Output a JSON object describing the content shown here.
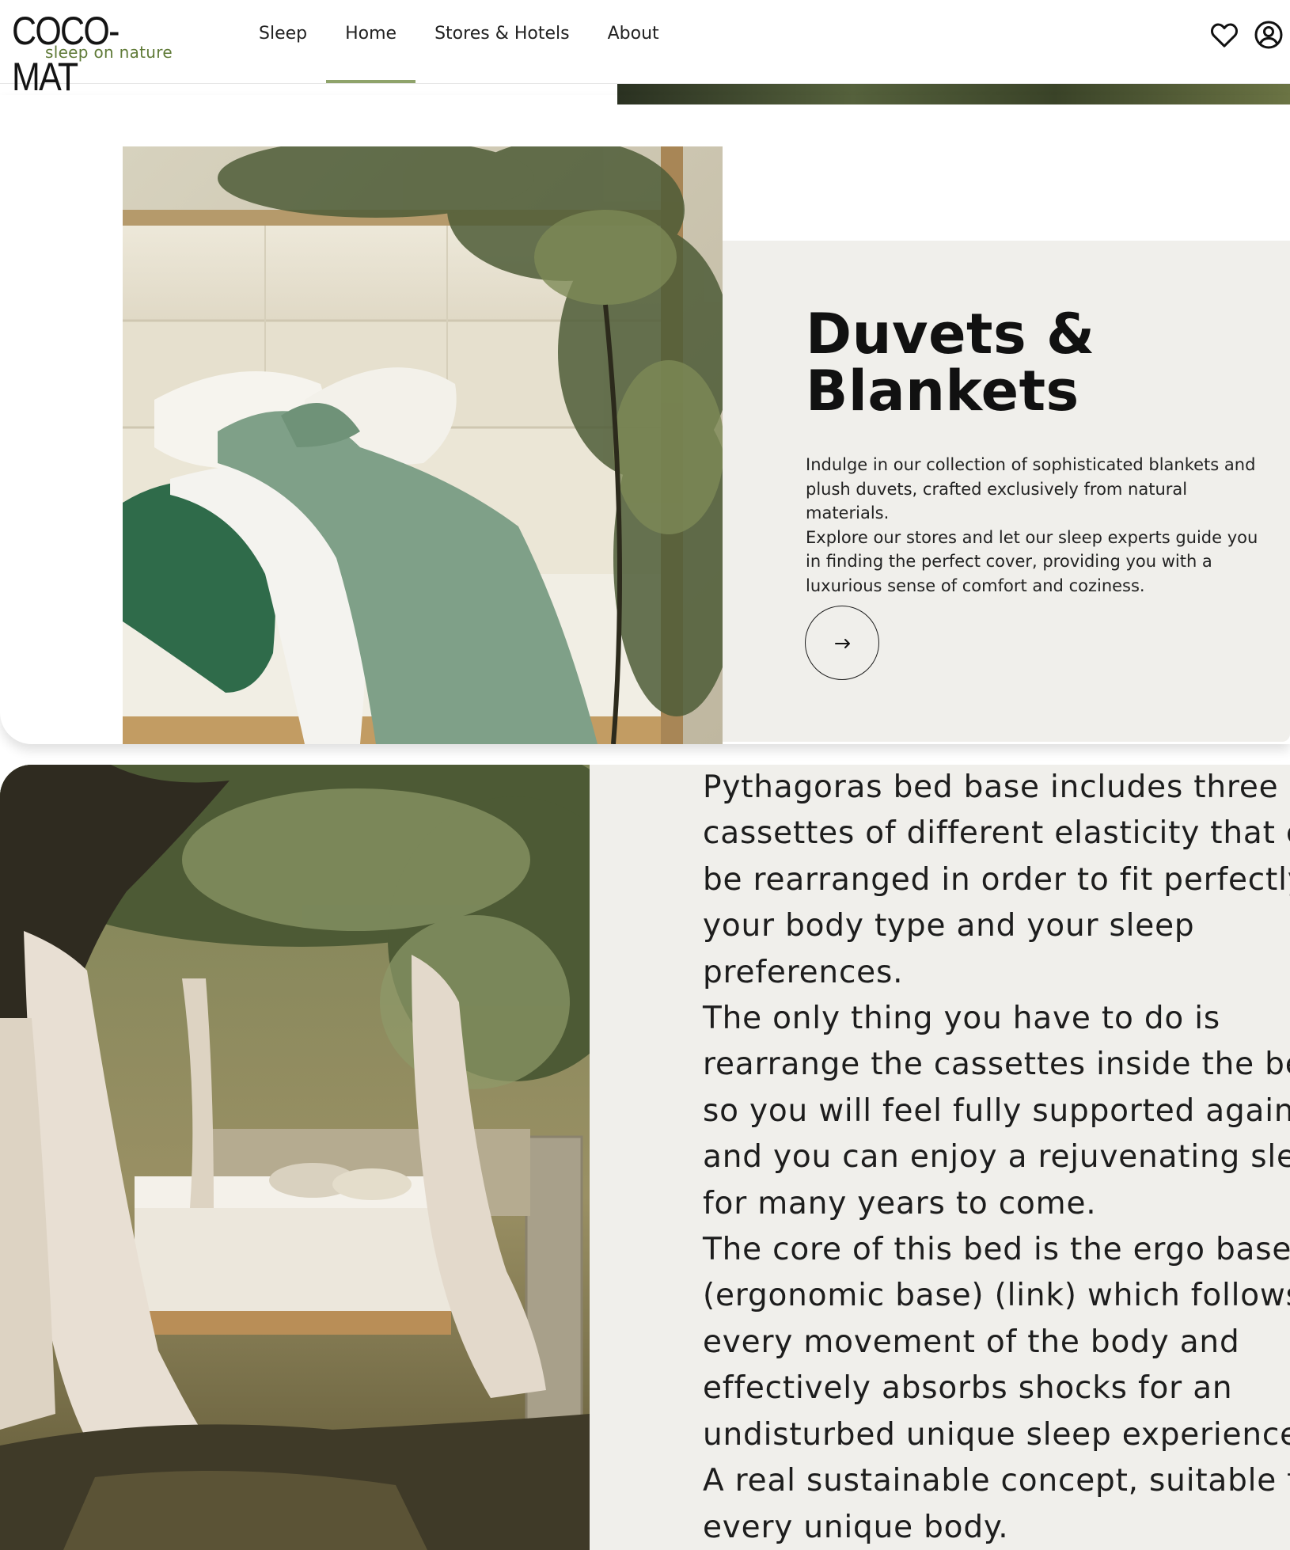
{
  "header": {
    "logo": {
      "name": "COCO-MAT",
      "tagline": "sleep on nature"
    },
    "nav": [
      {
        "label": "Sleep",
        "active": false
      },
      {
        "label": "Home",
        "active": true
      },
      {
        "label": "Stores & Hotels",
        "active": false
      },
      {
        "label": "About",
        "active": false
      }
    ],
    "icons": [
      "heart-icon",
      "account-icon"
    ]
  },
  "duvets": {
    "title_line1": "Duvets &",
    "title_line2": "Blankets",
    "description_lines": [
      "Indulge in our collection of sophisticated blankets and",
      "plush duvets, crafted exclusively from natural materials.",
      "Explore our stores and let our sleep experts guide you",
      "in finding the perfect cover, providing you with a",
      "luxurious sense of comfort and coziness."
    ],
    "arrow_icon": "arrow-right-icon"
  },
  "pythagoras": {
    "lines": [
      "Pythagoras bed base includes three",
      "cassettes of different elasticity that can",
      "be rearranged in order to fit perfectly to",
      "your body type and your sleep",
      "preferences.",
      "The only thing you have to do is",
      "rearrange the cassettes inside the bed",
      "so you will feel fully supported again",
      "and you can enjoy a rejuvenating sleep",
      "for many years to come.",
      "The core of this bed is the ergo base",
      "(ergonomic base) (link) which follows",
      "every movement of the body and",
      "effectively absorbs shocks for an",
      "undisturbed unique sleep experience.",
      "A real sustainable concept, suitable for",
      "every unique body."
    ]
  },
  "colors": {
    "accent": "#8fa36b",
    "logo_tagline": "#5f7a37",
    "panel_bg": "#f0efeb"
  }
}
